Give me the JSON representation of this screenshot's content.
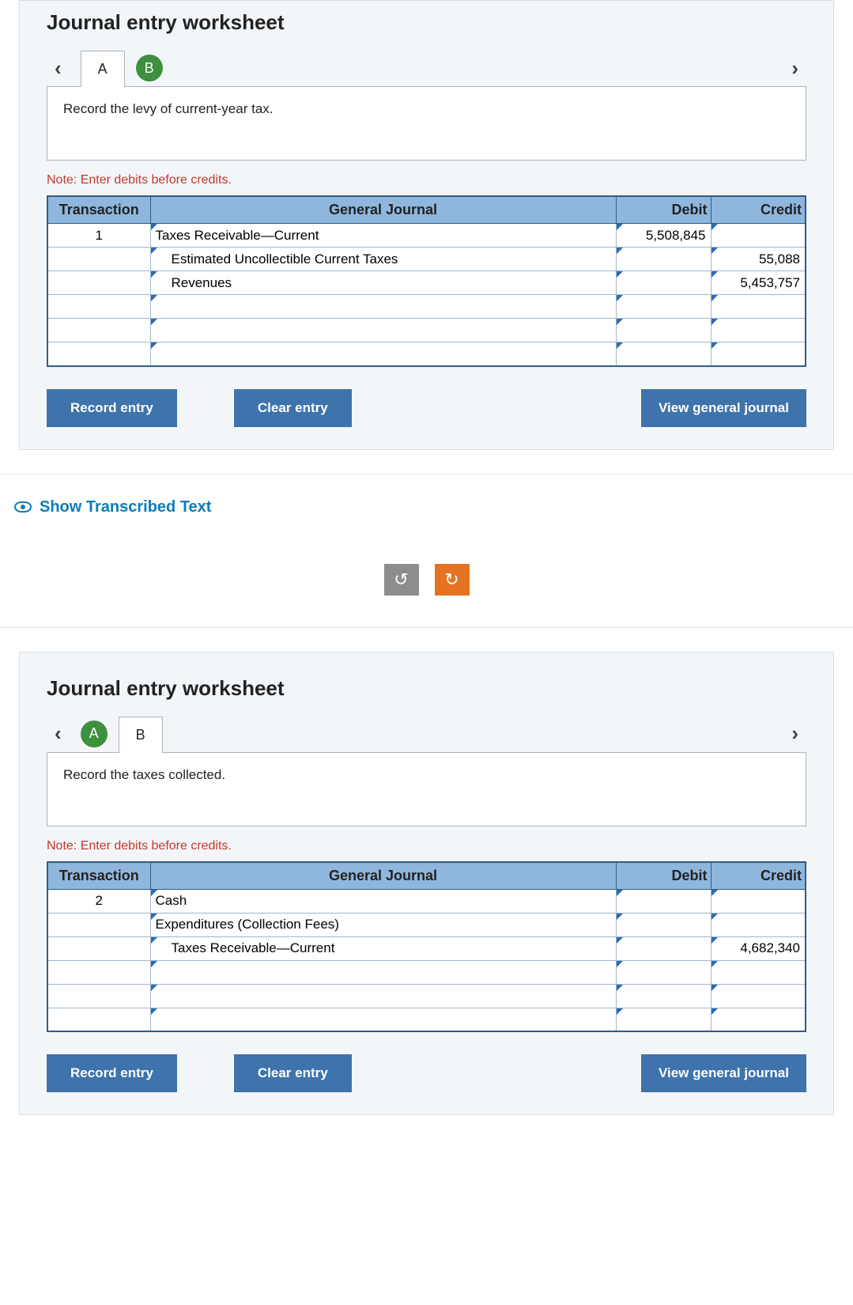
{
  "worksheets": [
    {
      "title": "Journal entry worksheet",
      "tabs": [
        {
          "label": "A",
          "state": "active"
        },
        {
          "label": "B",
          "state": "done"
        }
      ],
      "instruction": "Record the levy of current-year tax.",
      "note": "Note: Enter debits before credits.",
      "headers": {
        "transaction": "Transaction",
        "general_journal": "General Journal",
        "debit": "Debit",
        "credit": "Credit"
      },
      "rows": [
        {
          "transaction": "1",
          "account": "Taxes Receivable—Current",
          "indent": 0,
          "debit": "5,508,845",
          "credit": ""
        },
        {
          "transaction": "",
          "account": "Estimated Uncollectible Current Taxes",
          "indent": 1,
          "debit": "",
          "credit": "55,088"
        },
        {
          "transaction": "",
          "account": "Revenues",
          "indent": 1,
          "debit": "",
          "credit": "5,453,757"
        },
        {
          "transaction": "",
          "account": "",
          "indent": 0,
          "debit": "",
          "credit": ""
        },
        {
          "transaction": "",
          "account": "",
          "indent": 0,
          "debit": "",
          "credit": ""
        },
        {
          "transaction": "",
          "account": "",
          "indent": 0,
          "debit": "",
          "credit": ""
        }
      ],
      "buttons": {
        "record": "Record entry",
        "clear": "Clear entry",
        "view": "View general journal"
      }
    },
    {
      "title": "Journal entry worksheet",
      "tabs": [
        {
          "label": "A",
          "state": "done"
        },
        {
          "label": "B",
          "state": "active"
        }
      ],
      "instruction": "Record the taxes collected.",
      "note": "Note: Enter debits before credits.",
      "headers": {
        "transaction": "Transaction",
        "general_journal": "General Journal",
        "debit": "Debit",
        "credit": "Credit"
      },
      "rows": [
        {
          "transaction": "2",
          "account": "Cash",
          "indent": 0,
          "debit": "",
          "credit": ""
        },
        {
          "transaction": "",
          "account": "Expenditures (Collection Fees)",
          "indent": 0,
          "debit": "",
          "credit": ""
        },
        {
          "transaction": "",
          "account": "Taxes Receivable—Current",
          "indent": 1,
          "debit": "",
          "credit": "4,682,340"
        },
        {
          "transaction": "",
          "account": "",
          "indent": 0,
          "debit": "",
          "credit": ""
        },
        {
          "transaction": "",
          "account": "",
          "indent": 0,
          "debit": "",
          "credit": ""
        },
        {
          "transaction": "",
          "account": "",
          "indent": 0,
          "debit": "",
          "credit": ""
        }
      ],
      "buttons": {
        "record": "Record entry",
        "clear": "Clear entry",
        "view": "View general journal"
      }
    }
  ],
  "show_transcribed": "Show Transcribed Text",
  "reload_icons": {
    "left": "↺",
    "right": "↻"
  }
}
